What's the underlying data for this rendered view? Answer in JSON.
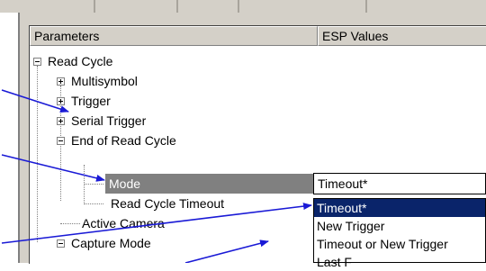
{
  "header": {
    "col_parameters": "Parameters",
    "col_esp_values": "ESP Values"
  },
  "tree": {
    "read_cycle": "Read Cycle",
    "multisymbol": "Multisymbol",
    "trigger": "Trigger",
    "serial_trigger": "Serial Trigger",
    "end_of_read_cycle": "End of Read Cycle",
    "mode": "Mode",
    "read_cycle_timeout": "Read Cycle Timeout",
    "active_camera": "Active Camera",
    "capture_mode": "Capture Mode"
  },
  "combo": {
    "value": "Timeout*"
  },
  "dropdown": {
    "options": [
      "Timeout*",
      "New Trigger",
      "Timeout or New Trigger",
      "Last F"
    ]
  },
  "colors": {
    "selected_row": "#808080",
    "dropdown_highlight": "#0a246a",
    "callout_arrow": "#1a1ad6"
  }
}
